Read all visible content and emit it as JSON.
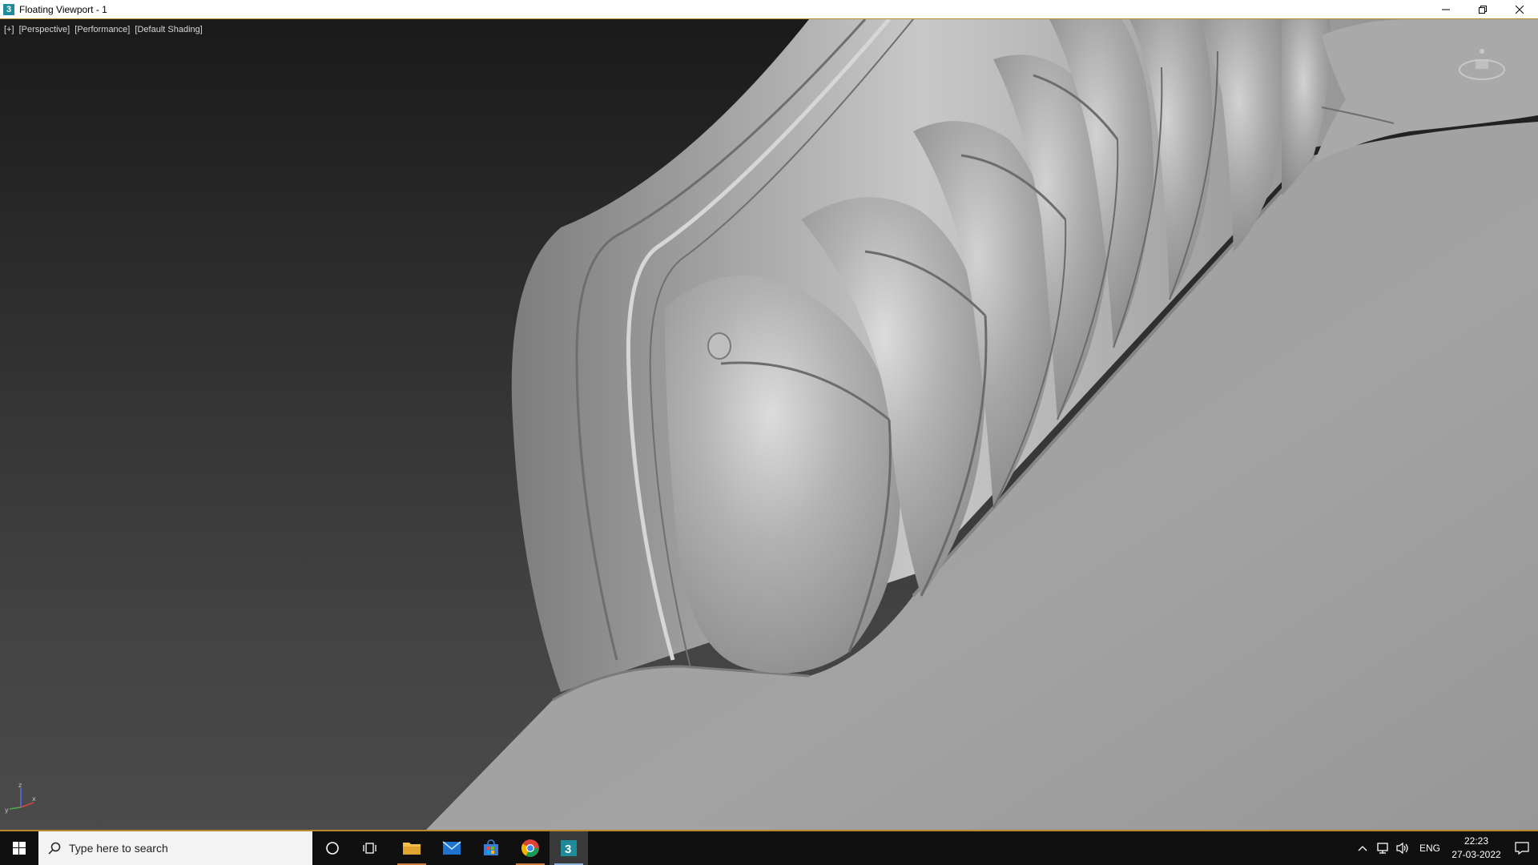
{
  "window": {
    "title": "Floating Viewport - 1",
    "icon": "3dsmax-icon",
    "controls": [
      "minimize-icon",
      "restore-icon",
      "close-icon"
    ]
  },
  "viewport": {
    "labels": [
      "[+]",
      "[Perspective]",
      "[Performance]",
      "[Default Shading]"
    ],
    "background_top": "#1a1a1a",
    "background_bottom": "#4b4b4b",
    "model_color": "#a8a8a8",
    "border_color": "#b58b2e",
    "axes": {
      "z": "z",
      "x": "x",
      "y": "y"
    }
  },
  "taskbar": {
    "search_placeholder": "Type here to search",
    "apps": [
      "cortana-icon",
      "task-view-icon",
      "file-explorer-icon",
      "mail-icon",
      "store-icon",
      "chrome-icon",
      "3dsmax-icon"
    ],
    "tray": {
      "language": "ENG",
      "time": "22:23",
      "date": "27-03-2022"
    }
  }
}
